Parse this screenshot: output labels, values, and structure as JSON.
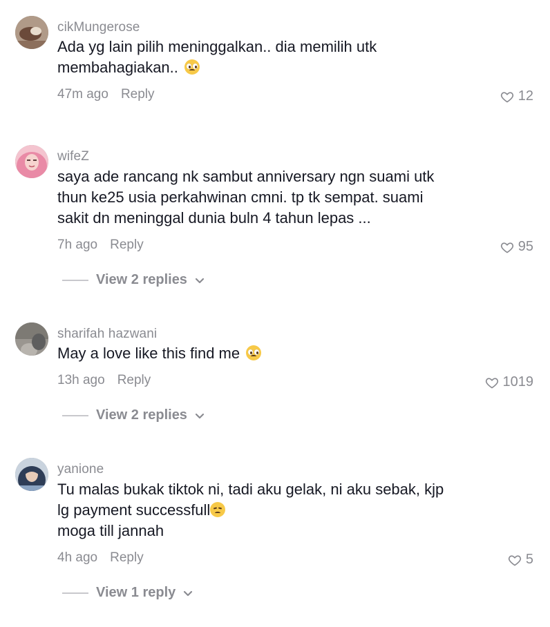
{
  "comments": [
    {
      "username": "cikMungerose",
      "lines": [
        "Ada yg lain pilih meninggalkan.. dia memilih utk",
        "membahagiakan.. "
      ],
      "emoji": "pleading-face",
      "time": "47m ago",
      "reply_label": "Reply",
      "likes": "12",
      "avatar_colors": [
        "#6b4a3a",
        "#d9c9b8"
      ]
    },
    {
      "username": "wifeZ",
      "lines": [
        "saya ade rancang nk sambut anniversary ngn suami utk",
        "thun ke25 usia perkahwinan cmni. tp tk sempat. suami",
        "sakit dn meninggal dunia buln 4 tahun lepas ..."
      ],
      "time": "7h ago",
      "reply_label": "Reply",
      "likes": "95",
      "view_replies": "View 2 replies",
      "avatar_colors": [
        "#e98aa6",
        "#f6d3cf"
      ]
    },
    {
      "username": "sharifah hazwani",
      "lines": [
        "May a love like this find me "
      ],
      "emoji": "pleading-face",
      "time": "13h ago",
      "reply_label": "Reply",
      "likes": "1019",
      "view_replies": "View 2 replies",
      "avatar_colors": [
        "#5e5e5e",
        "#b8b4ae"
      ]
    },
    {
      "username": "yanione",
      "lines": [
        "Tu malas bukak tiktok ni, tadi aku gelak, ni aku sebak, kjp",
        "lg payment successfull",
        "moga till jannah"
      ],
      "emoji_line2": "disappointed-face",
      "time": "4h ago",
      "reply_label": "Reply",
      "likes": "5",
      "view_replies": "View 1 reply",
      "avatar_colors": [
        "#2e3d57",
        "#8aa3c2"
      ]
    }
  ],
  "icons": {
    "like": "heart-outline-icon",
    "expand": "chevron-down-icon"
  },
  "colors": {
    "text": "#161823",
    "secondary": "#8a8b91",
    "background": "#ffffff"
  }
}
